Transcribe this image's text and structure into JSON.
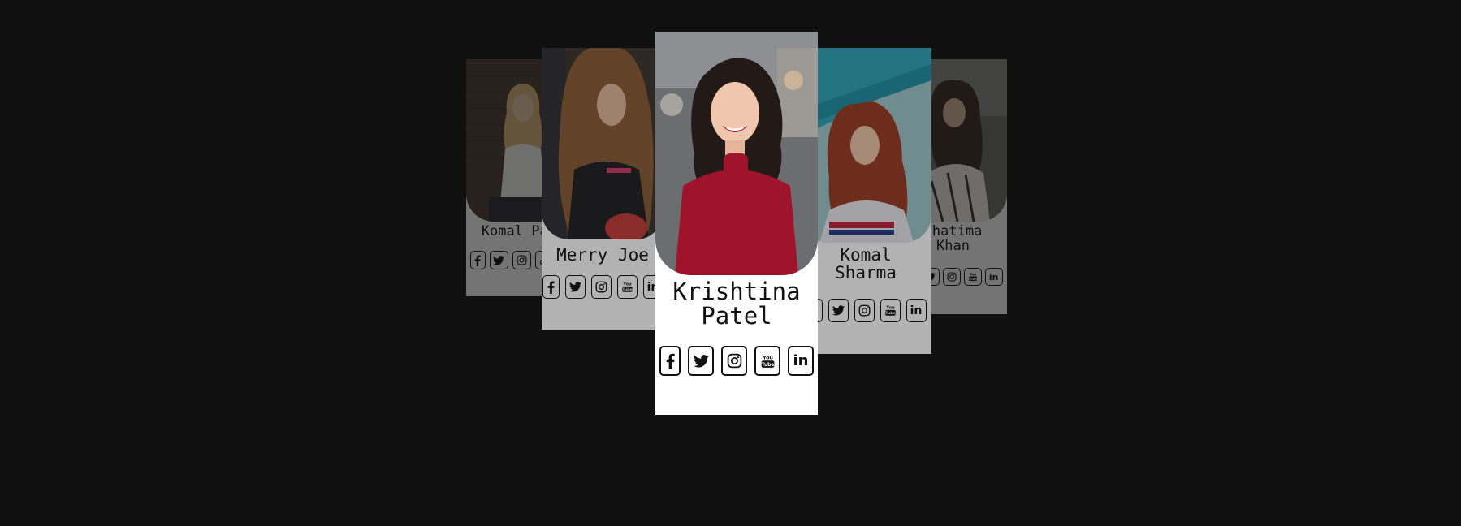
{
  "cards": [
    {
      "name": "Komal Paul",
      "photo": "woman-white-top-brick-wall",
      "bg": "#4a3a30",
      "accent": "#f2f2ee"
    },
    {
      "name": "Merry Joe",
      "photo": "woman-long-hair-boxing-glove",
      "bg": "#3b342f",
      "accent": "#c43a36"
    },
    {
      "name": "Krishtina Patel",
      "photo": "woman-smiling-red-sweater",
      "bg": "#6b6d70",
      "accent": "#a0142b"
    },
    {
      "name": "Komal Sharma",
      "photo": "woman-red-hair-teal-wall",
      "bg": "#2fa3b7",
      "accent": "#e9e9ef"
    },
    {
      "name": "Fhatima Khan",
      "photo": "woman-striped-shirt",
      "bg": "#6d6c6a",
      "accent": "#f0eeea"
    }
  ],
  "social_icons": [
    "facebook-icon",
    "twitter-icon",
    "instagram-icon",
    "youtube-icon",
    "linkedin-icon"
  ],
  "youtube_text": "You Tube",
  "linkedin_text": "in",
  "colors": {
    "page_bg": "#101010",
    "card_bg": "#ffffff",
    "ink": "#111111"
  }
}
